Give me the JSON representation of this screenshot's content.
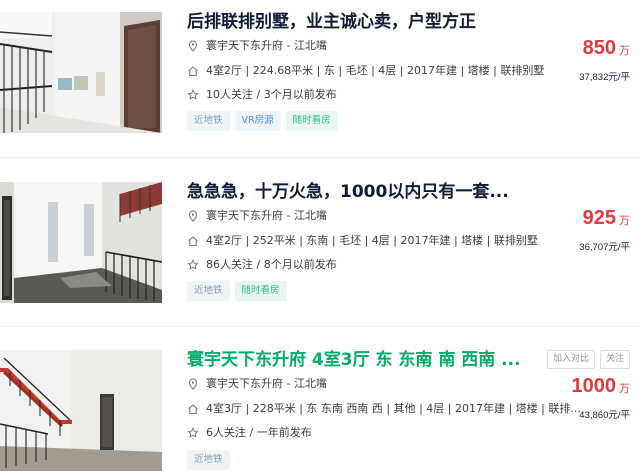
{
  "listings": [
    {
      "title": "后排联排别墅，业主诚心卖，户型方正",
      "community": "寰宇天下东升府 - 江北嘴",
      "house_info": "4室2厅 | 224.68平米 | 东 | 毛坯 | 4层 | 2017年建 | 塔楼 | 联排别墅",
      "follow_info": "10人关注 / 3个月以前发布",
      "tags": [
        "近地铁",
        "VR房源",
        "随时看房"
      ],
      "total_price": "850",
      "price_unit": "万",
      "unit_price": "37,832元/平"
    },
    {
      "title": "急急急，十万火急，1000以内只有一套...",
      "community": "寰宇天下东升府 - 江北嘴",
      "house_info": "4室2厅 | 252平米 | 东南 | 毛坯 | 4层 | 2017年建 | 塔楼 | 联排别墅",
      "follow_info": "86人关注 / 8个月以前发布",
      "tags": [
        "近地铁",
        "随时看房"
      ],
      "total_price": "925",
      "price_unit": "万",
      "unit_price": "36,707元/平"
    },
    {
      "title": "寰宇天下东升府 4室3厅 东 东南 南 西南 ...",
      "community": "寰宇天下东升府 - 江北嘴",
      "house_info": "4室3厅 | 228平米 | 东 东南 西南 西 | 其他 | 4层 | 2017年建 | 塔楼 | 联排...",
      "follow_info": "6人关注 / 一年前发布",
      "tags": [
        "近地铁"
      ],
      "total_price": "1000",
      "price_unit": "万",
      "unit_price": "43,860元/平",
      "actions": [
        "加入对比",
        "关注"
      ]
    }
  ],
  "colors": {
    "price": "#e4393c",
    "title_highlight": "#00ae66",
    "text": "#101d37"
  },
  "icons": {
    "location": "location-pin-icon",
    "house": "house-icon",
    "follow": "star-icon"
  }
}
